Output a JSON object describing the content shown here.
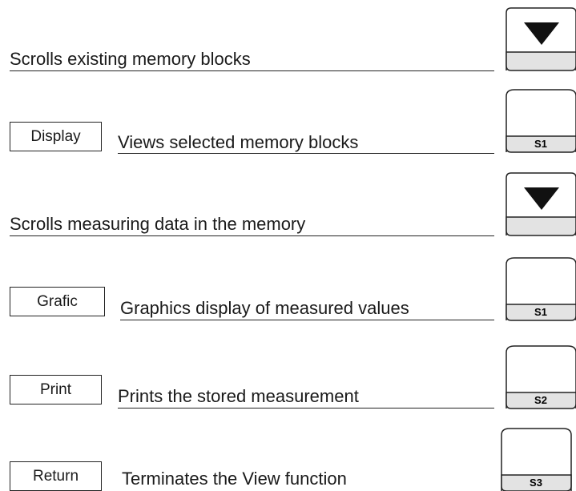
{
  "rows": [
    {
      "label": "",
      "description": "Scrolls existing memory blocks",
      "key": {
        "type": "arrow",
        "icon": "down-triangle-icon"
      }
    },
    {
      "label": "Display",
      "description": "Views selected memory blocks",
      "key": {
        "type": "softkey",
        "text": "S1"
      }
    },
    {
      "label": "",
      "description": "Scrolls measuring data in the memory",
      "key": {
        "type": "arrow",
        "icon": "down-triangle-icon"
      }
    },
    {
      "label": "Grafic",
      "description": "Graphics display of measured values",
      "key": {
        "type": "softkey",
        "text": "S1"
      }
    },
    {
      "label": "Print",
      "description": "Prints the stored measurement",
      "key": {
        "type": "softkey",
        "text": "S2"
      }
    },
    {
      "label": "Return",
      "description": "Terminates the View function",
      "key": {
        "type": "softkey",
        "text": "S3"
      }
    }
  ],
  "colors": {
    "key_band": "#e3e3e3",
    "outline": "#222222",
    "arrow": "#111111"
  }
}
